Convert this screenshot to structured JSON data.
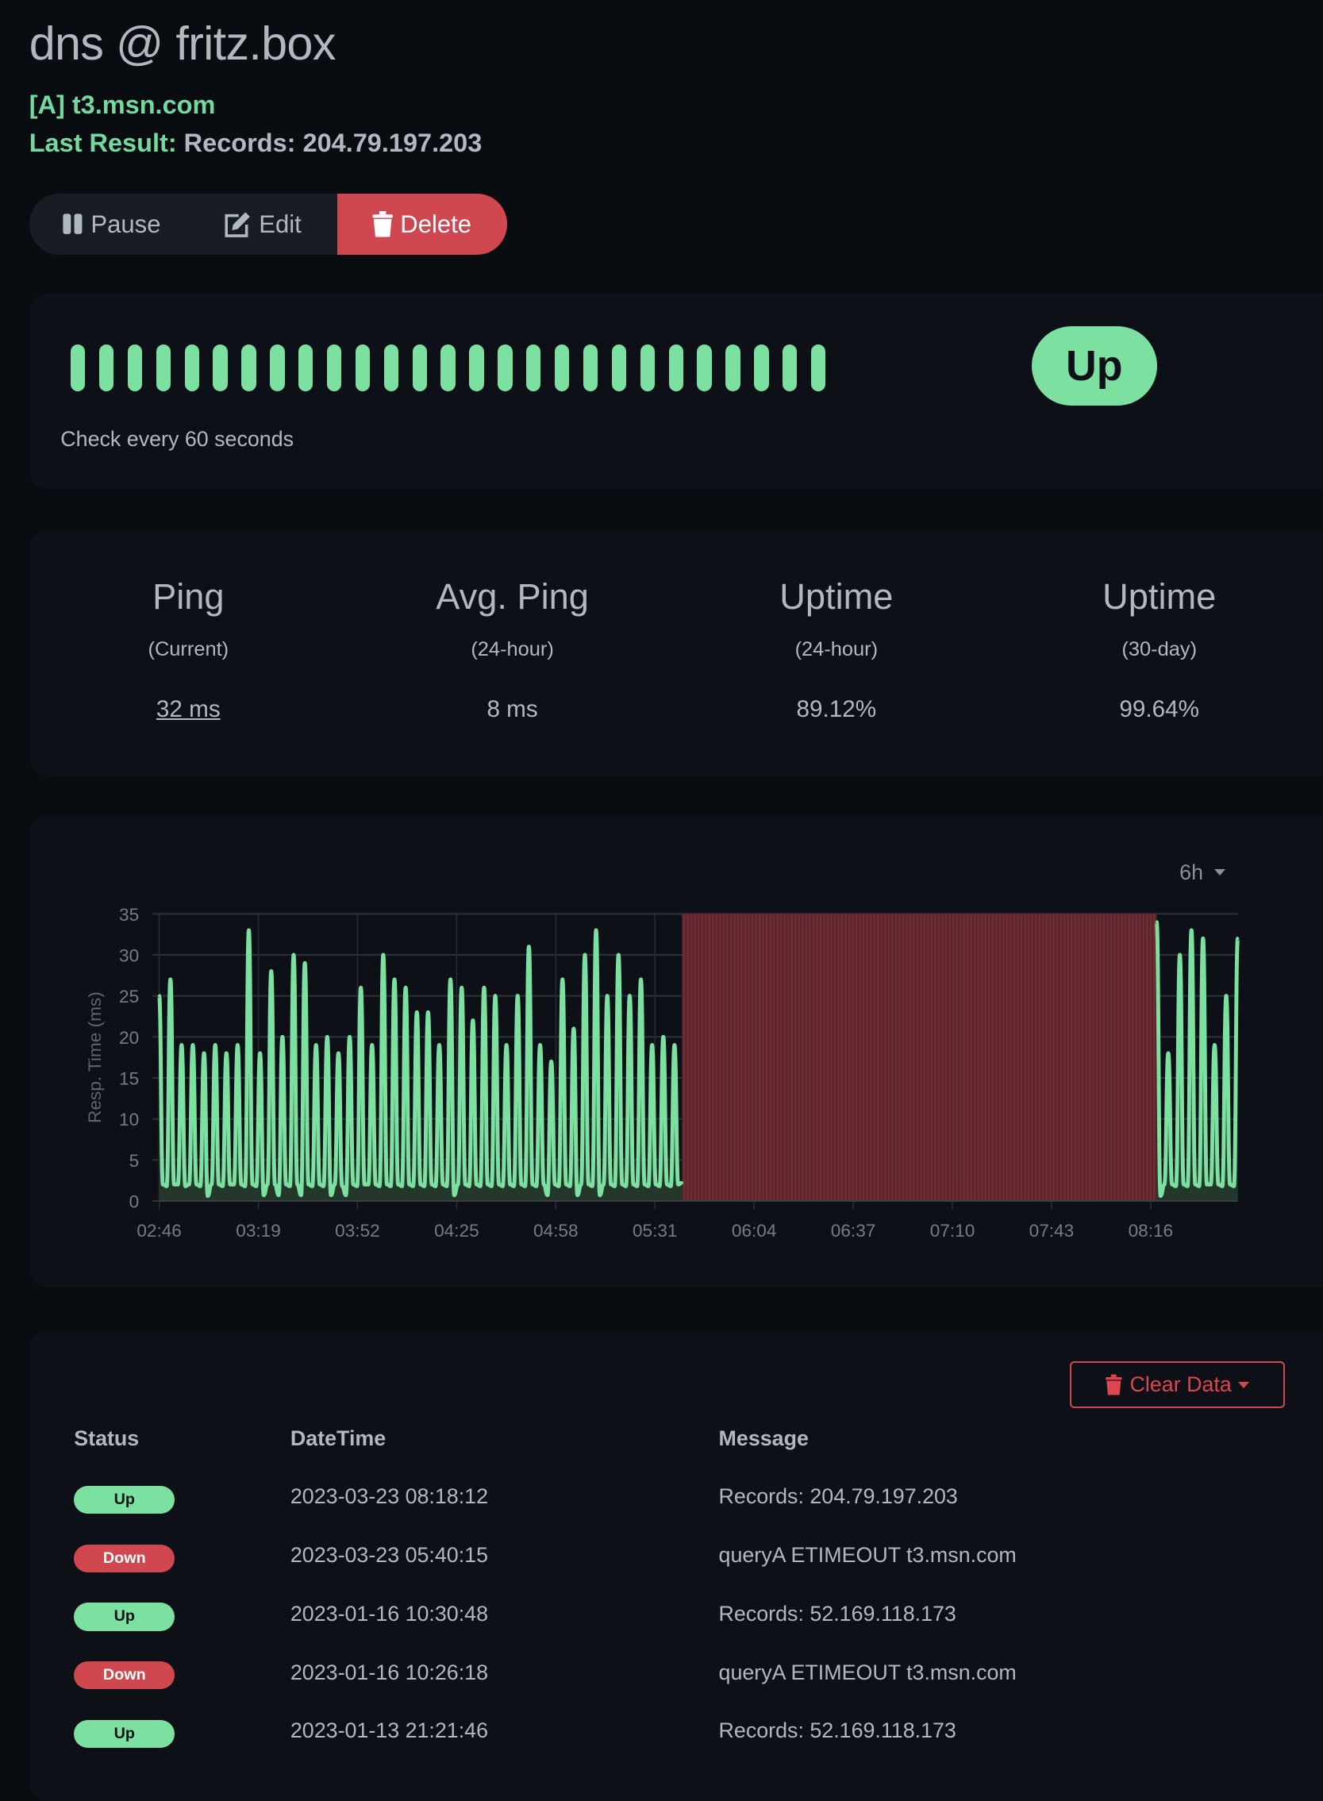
{
  "header": {
    "title": "dns @ fritz.box",
    "subtitle": "[A] t3.msn.com",
    "last_result_label": "Last Result:",
    "last_result_value": "Records: 204.79.197.203"
  },
  "toolbar": {
    "pause_label": "Pause",
    "edit_label": "Edit",
    "delete_label": "Delete"
  },
  "heartbeat": {
    "beats": [
      "up",
      "up",
      "up",
      "up",
      "up",
      "up",
      "up",
      "up",
      "up",
      "up",
      "up",
      "up",
      "up",
      "up",
      "up",
      "up",
      "up",
      "up",
      "up",
      "up",
      "up",
      "up",
      "up",
      "up",
      "up",
      "up",
      "up"
    ],
    "status": "Up",
    "interval_text": "Check every 60 seconds"
  },
  "stats": [
    {
      "title": "Ping",
      "sub": "(Current)",
      "value": "32 ms"
    },
    {
      "title": "Avg. Ping",
      "sub": "(24-hour)",
      "value": "8 ms"
    },
    {
      "title": "Uptime",
      "sub": "(24-hour)",
      "value": "89.12%"
    },
    {
      "title": "Uptime",
      "sub": "(30-day)",
      "value": "99.64%"
    }
  ],
  "colors": {
    "up": "#7ce0a0",
    "down": "#cf474f",
    "background": "#090c10",
    "card": "#0d1117"
  },
  "chart_data": {
    "type": "line",
    "range_selector": "6h",
    "ylabel": "Resp. Time (ms)",
    "ylim": [
      0,
      35
    ],
    "yticks": [
      "0",
      "5",
      "10",
      "15",
      "20",
      "25",
      "30",
      "35"
    ],
    "xticks": [
      "02:46",
      "03:19",
      "03:52",
      "04:25",
      "04:58",
      "05:31",
      "06:04",
      "06:37",
      "07:10",
      "07:43",
      "08:16"
    ],
    "xlim": [
      "02:46",
      "08:45"
    ],
    "grid": true,
    "down_period": {
      "start": "05:40",
      "end": "08:18"
    },
    "segments": [
      {
        "start": "02:46",
        "end": "05:40",
        "values": [
          25,
          2,
          1.8,
          27,
          2,
          2,
          19,
          1.8,
          2,
          19,
          2,
          1.8,
          18,
          0.6,
          2,
          19,
          2,
          1.8,
          18,
          2,
          2,
          19,
          2,
          1.8,
          33,
          2,
          1.8,
          18,
          0.7,
          2,
          28,
          2,
          0.7,
          20,
          2,
          1.8,
          30,
          2,
          0.7,
          29,
          2,
          1.8,
          19,
          2,
          1.8,
          20,
          0.7,
          2,
          18,
          1.8,
          0.7,
          20,
          2,
          1.8,
          26,
          2,
          2,
          19,
          2,
          1.8,
          30,
          2,
          1.8,
          27,
          2,
          1.8,
          26,
          2,
          1.8,
          23,
          2,
          1.8,
          23,
          2,
          1.8,
          19,
          2,
          1.8,
          27,
          0.7,
          2,
          26,
          2,
          1.8,
          22,
          2,
          1.8,
          26,
          2,
          1.8,
          25,
          2,
          1.8,
          19,
          2,
          1.8,
          25,
          2,
          1.8,
          31,
          2,
          1.8,
          19,
          2,
          0.7,
          17,
          2,
          1.8,
          27,
          2,
          1.8,
          21,
          0.7,
          2,
          30,
          2,
          1.8,
          33,
          0.7,
          2,
          25,
          2,
          1.8,
          30,
          2,
          1.8,
          25,
          2,
          1.8,
          27,
          2,
          1.8,
          19,
          2,
          1.8,
          20,
          2,
          1.8,
          19,
          2,
          2.2
        ]
      },
      {
        "start": "08:18",
        "end": "08:45",
        "values": [
          34,
          0.6,
          2,
          18,
          2,
          1.8,
          30,
          2,
          1.8,
          33,
          2,
          1.8,
          32,
          2,
          2,
          19,
          2,
          1.8,
          25,
          2,
          1.8,
          32
        ]
      }
    ]
  },
  "events": {
    "clear_label": "Clear Data",
    "columns": [
      "Status",
      "DateTime",
      "Message"
    ],
    "rows": [
      {
        "status": "Up",
        "datetime": "2023-03-23 08:18:12",
        "message": "Records: 204.79.197.203"
      },
      {
        "status": "Down",
        "datetime": "2023-03-23 05:40:15",
        "message": "queryA ETIMEOUT t3.msn.com"
      },
      {
        "status": "Up",
        "datetime": "2023-01-16 10:30:48",
        "message": "Records: 52.169.118.173"
      },
      {
        "status": "Down",
        "datetime": "2023-01-16 10:26:18",
        "message": "queryA ETIMEOUT t3.msn.com"
      },
      {
        "status": "Up",
        "datetime": "2023-01-13 21:21:46",
        "message": "Records: 52.169.118.173"
      }
    ]
  }
}
